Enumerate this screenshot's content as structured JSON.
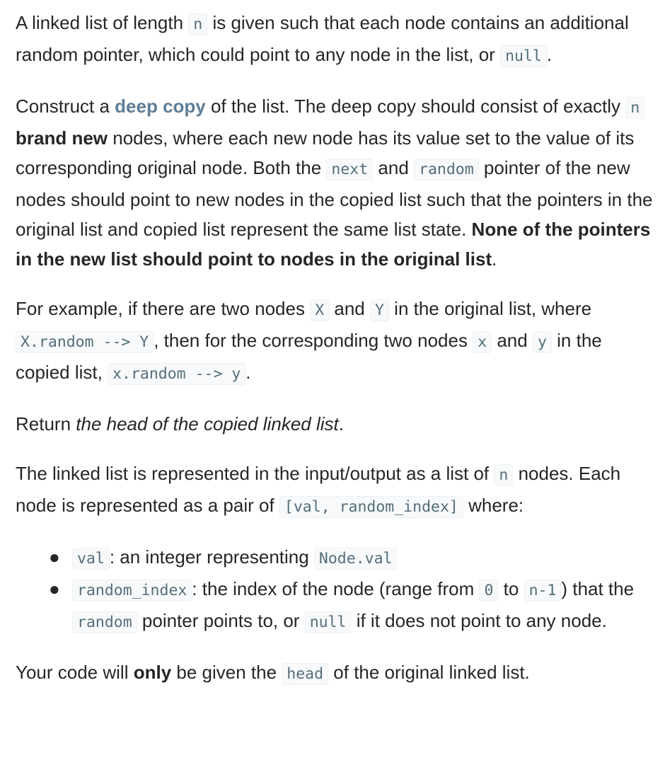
{
  "p1": {
    "t1": "A linked list of length ",
    "c1": "n",
    "t2": " is given such that each node contains an additional random pointer, which could point to any node in the list, or ",
    "c2": "null",
    "t3": "."
  },
  "p2": {
    "t1": "Construct a ",
    "link": "deep copy",
    "t2": " of the list. The deep copy should consist of exactly ",
    "c1": "n",
    "t3": " ",
    "b1": "brand new",
    "t4": " nodes, where each new node has its value set to the value of its corresponding original node. Both the ",
    "c2": "next",
    "t5": " and ",
    "c3": "random",
    "t6": " pointer of the new nodes should point to new nodes in the copied list such that the pointers in the original list and copied list represent the same list state. ",
    "b2": "None of the pointers in the new list should point to nodes in the original list",
    "t7": "."
  },
  "p3": {
    "t1": "For example, if there are two nodes ",
    "c1": "X",
    "t2": " and ",
    "c2": "Y",
    "t3": " in the original list, where ",
    "c3": "X.random --> Y",
    "t4": ", then for the corresponding two nodes ",
    "c4": "x",
    "t5": " and ",
    "c5": "y",
    "t6": " in the copied list, ",
    "c6": "x.random --> y",
    "t7": "."
  },
  "p4": {
    "t1": "Return ",
    "i1": "the head of the copied linked list",
    "t2": "."
  },
  "p5": {
    "t1": "The linked list is represented in the input/output as a list of ",
    "c1": "n",
    "t2": " nodes. Each node is represented as a pair of ",
    "c2": "[val, random_index]",
    "t3": " where:"
  },
  "bullets": {
    "symbol": "●",
    "item1": {
      "c1": "val",
      "t1": ": an integer representing ",
      "c2": "Node.val"
    },
    "item2": {
      "c1": "random_index",
      "t1": ": the index of the node (range from ",
      "c2": "0",
      "t2": " to ",
      "c3": "n-1",
      "t3": ") that the ",
      "c4": "random",
      "t4": " pointer points to, or ",
      "c5": "null",
      "t5": " if it does not point to any node."
    }
  },
  "p6": {
    "t1": "Your code will ",
    "b1": "only",
    "t2": " be given the ",
    "c1": "head",
    "t3": " of the original linked list."
  },
  "colors": {
    "text": "#262626",
    "code_text": "#546e7a",
    "code_bg": "#f7f9fa",
    "link": "#5f7d95"
  }
}
